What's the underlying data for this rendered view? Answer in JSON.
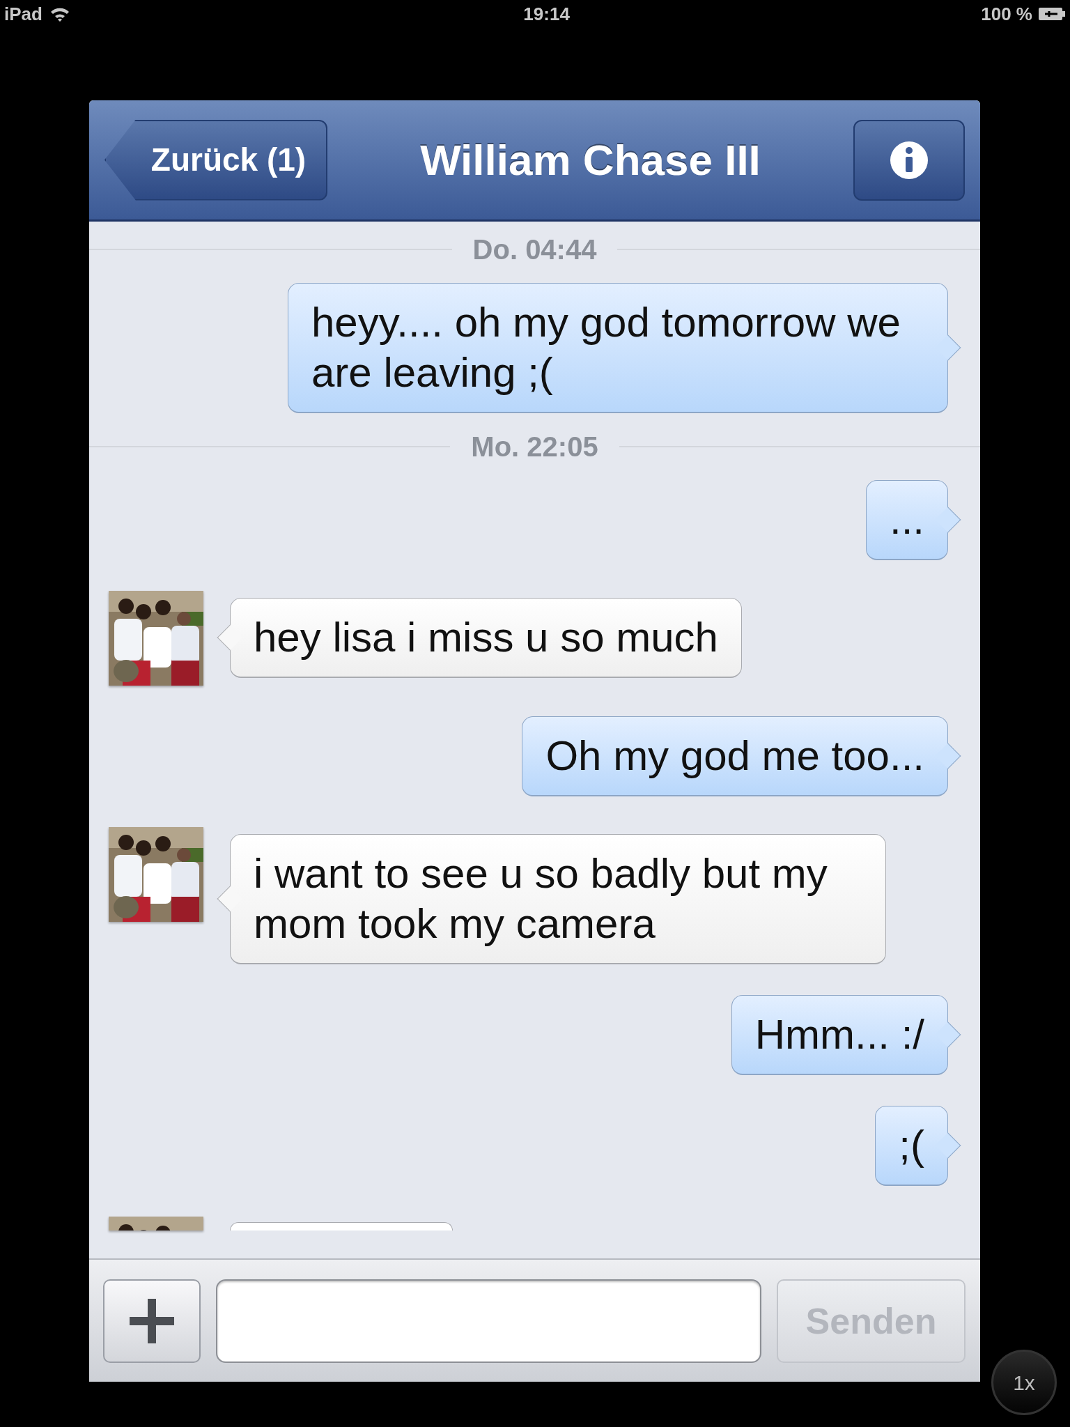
{
  "status_bar": {
    "device": "iPad",
    "time": "19:14",
    "battery": "100 %"
  },
  "header": {
    "back": "Zurück (1)",
    "title": "William Chase III"
  },
  "messages": [
    {
      "kind": "date",
      "text": "Do. 04:44"
    },
    {
      "kind": "outgoing",
      "text": "heyy.... oh my god tomorrow we are leaving ;("
    },
    {
      "kind": "date",
      "text": "Mo. 22:05"
    },
    {
      "kind": "outgoing",
      "text": "..."
    },
    {
      "kind": "incoming",
      "text": "hey lisa i miss u so much"
    },
    {
      "kind": "outgoing",
      "text": "Oh my god me too..."
    },
    {
      "kind": "incoming",
      "text": "i want to see u so badly but my mom took my camera"
    },
    {
      "kind": "outgoing",
      "text": "Hmm... :/"
    },
    {
      "kind": "outgoing",
      "text": ";("
    },
    {
      "kind": "incoming_partial"
    }
  ],
  "composer": {
    "send": "Senden",
    "send_disabled": true
  },
  "zoom_button": "1x"
}
